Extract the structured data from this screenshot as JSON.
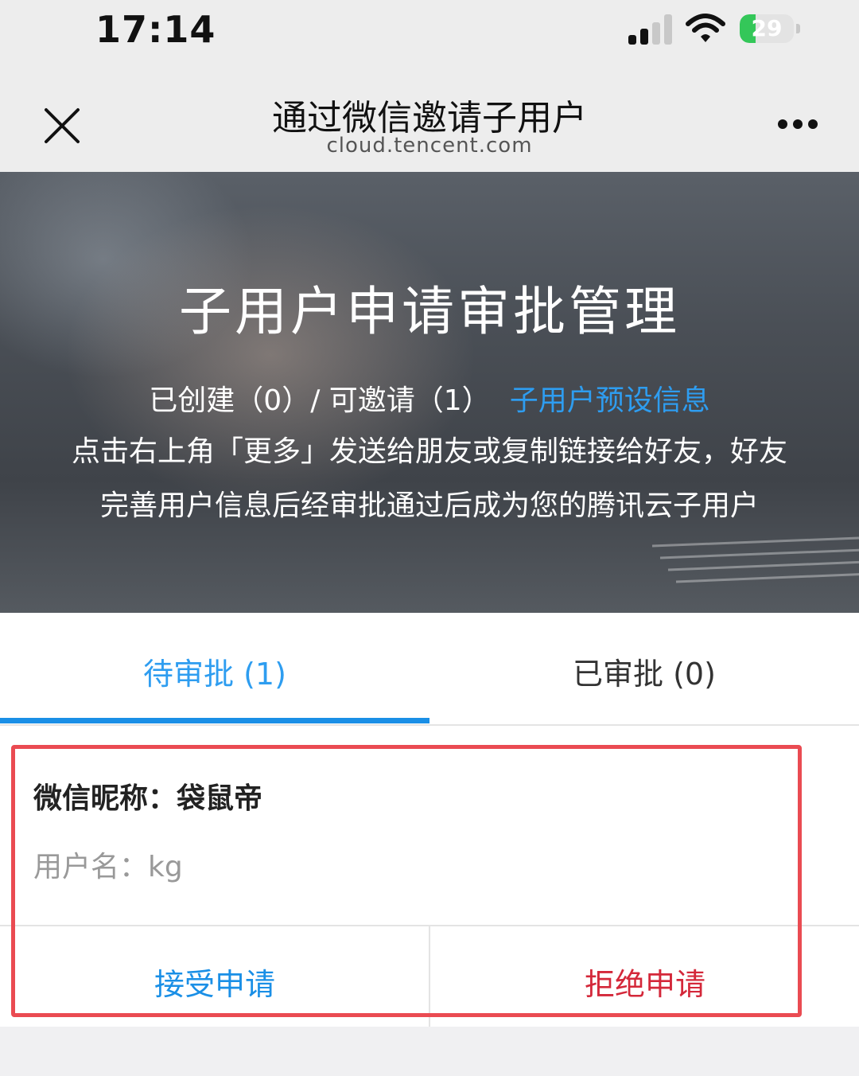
{
  "status_bar": {
    "time": "17:14",
    "battery_level": "29",
    "icons": [
      "signal-icon",
      "wifi-icon",
      "battery-icon"
    ]
  },
  "nav": {
    "title": "通过微信邀请子用户",
    "subtitle": "cloud.tencent.com",
    "icons": [
      "close-icon",
      "more-icon"
    ]
  },
  "banner": {
    "title": "子用户申请审批管理",
    "stats": "已创建（0）/ 可邀请（1）",
    "preset_link": "子用户预设信息",
    "description_line1": "点击右上角「更多」发送给朋友或复制链接给好友，好友",
    "description_line2": "完善用户信息后经审批通过后成为您的腾讯云子用户"
  },
  "tabs": [
    {
      "label": "待审批 (1)",
      "active": true
    },
    {
      "label": "已审批 (0)",
      "active": false
    }
  ],
  "application": {
    "nickname": "微信昵称：袋鼠帝",
    "username": "用户名：kg",
    "accept_label": "接受申请",
    "reject_label": "拒绝申请"
  },
  "colors": {
    "accent": "#1a8fe6",
    "link": "#2e9df0",
    "reject": "#d4283a",
    "highlight": "#ea4b52",
    "battery": "#34c759"
  }
}
